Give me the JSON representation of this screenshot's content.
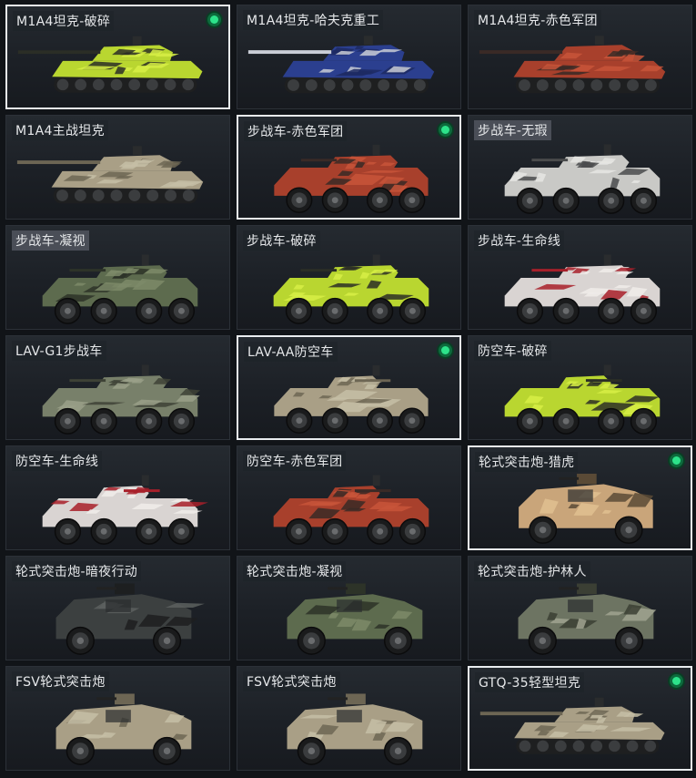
{
  "vehicles": [
    {
      "title": "M1A4坦克-破碎",
      "kind": "tank",
      "camo": "shatter",
      "selected": true,
      "dot": true,
      "plate": false
    },
    {
      "title": "M1A4坦克-哈夫克重工",
      "kind": "tank",
      "camo": "haavk",
      "selected": false,
      "dot": false,
      "plate": false
    },
    {
      "title": "M1A4坦克-赤色军团",
      "kind": "tank",
      "camo": "red",
      "selected": false,
      "dot": false,
      "plate": false
    },
    {
      "title": "M1A4主战坦克",
      "kind": "tank",
      "camo": "sand",
      "selected": false,
      "dot": false,
      "plate": false
    },
    {
      "title": "步战车-赤色军团",
      "kind": "ifv",
      "camo": "red",
      "selected": true,
      "dot": true,
      "plate": false
    },
    {
      "title": "步战车-无瑕",
      "kind": "ifv",
      "camo": "white",
      "selected": false,
      "dot": false,
      "plate": true
    },
    {
      "title": "步战车-凝视",
      "kind": "ifv",
      "camo": "green",
      "selected": false,
      "dot": false,
      "plate": true
    },
    {
      "title": "步战车-破碎",
      "kind": "ifv",
      "camo": "shatter",
      "selected": false,
      "dot": false,
      "plate": false
    },
    {
      "title": "步战车-生命线",
      "kind": "ifv",
      "camo": "lifeline",
      "selected": false,
      "dot": false,
      "plate": false
    },
    {
      "title": "LAV-G1步战车",
      "kind": "ifv",
      "camo": "olive",
      "selected": false,
      "dot": false,
      "plate": false
    },
    {
      "title": "LAV-AA防空车",
      "kind": "aa",
      "camo": "sand",
      "selected": true,
      "dot": true,
      "plate": false
    },
    {
      "title": "防空车-破碎",
      "kind": "aa",
      "camo": "shatter",
      "selected": false,
      "dot": false,
      "plate": false
    },
    {
      "title": "防空车-生命线",
      "kind": "aa",
      "camo": "lifeline",
      "selected": false,
      "dot": false,
      "plate": false
    },
    {
      "title": "防空车-赤色军团",
      "kind": "aa",
      "camo": "red",
      "selected": false,
      "dot": false,
      "plate": false
    },
    {
      "title": "轮式突击炮-猎虎",
      "kind": "assault",
      "camo": "tiger",
      "selected": true,
      "dot": true,
      "plate": false
    },
    {
      "title": "轮式突击炮-暗夜行动",
      "kind": "assault",
      "camo": "dark",
      "selected": false,
      "dot": false,
      "plate": false
    },
    {
      "title": "轮式突击炮-凝视",
      "kind": "assault",
      "camo": "green",
      "selected": false,
      "dot": false,
      "plate": false
    },
    {
      "title": "轮式突击炮-护林人",
      "kind": "assault",
      "camo": "forest",
      "selected": false,
      "dot": false,
      "plate": false
    },
    {
      "title": "FSV轮式突击炮",
      "kind": "assault",
      "camo": "sand",
      "selected": false,
      "dot": false,
      "plate": false
    },
    {
      "title": "FSV轮式突击炮",
      "kind": "assault",
      "camo": "sand",
      "selected": false,
      "dot": false,
      "plate": false
    },
    {
      "title": "GTQ-35轻型坦克",
      "kind": "lighttank",
      "camo": "sand",
      "selected": true,
      "dot": true,
      "plate": false
    }
  ],
  "palettes": {
    "shatter": [
      "#b9d630",
      "#2b2e26",
      "#d7ee45"
    ],
    "haavk": [
      "#2b3f8f",
      "#c9cdd6",
      "#1d2a63"
    ],
    "red": [
      "#a8402c",
      "#3a2a26",
      "#c8553a"
    ],
    "sand": [
      "#a99f86",
      "#6d6654",
      "#c6bea6"
    ],
    "white": [
      "#c9c9c6",
      "#4a4b4c",
      "#e6e6e3"
    ],
    "green": [
      "#5d6b4e",
      "#2d3328",
      "#7c8a69"
    ],
    "lifeline": [
      "#d9d4d2",
      "#a8202a",
      "#f0ecea"
    ],
    "olive": [
      "#78806a",
      "#3e4236",
      "#9aa088"
    ],
    "tiger": [
      "#c9a57a",
      "#5a4a36",
      "#e0c090"
    ],
    "dark": [
      "#3c4040",
      "#1d1f20",
      "#5c605f"
    ],
    "forest": [
      "#6d7462",
      "#3b3f34",
      "#a0a390"
    ]
  },
  "colors": {
    "selected_border": "#e9ecef",
    "status_dot": "#2de38a"
  }
}
